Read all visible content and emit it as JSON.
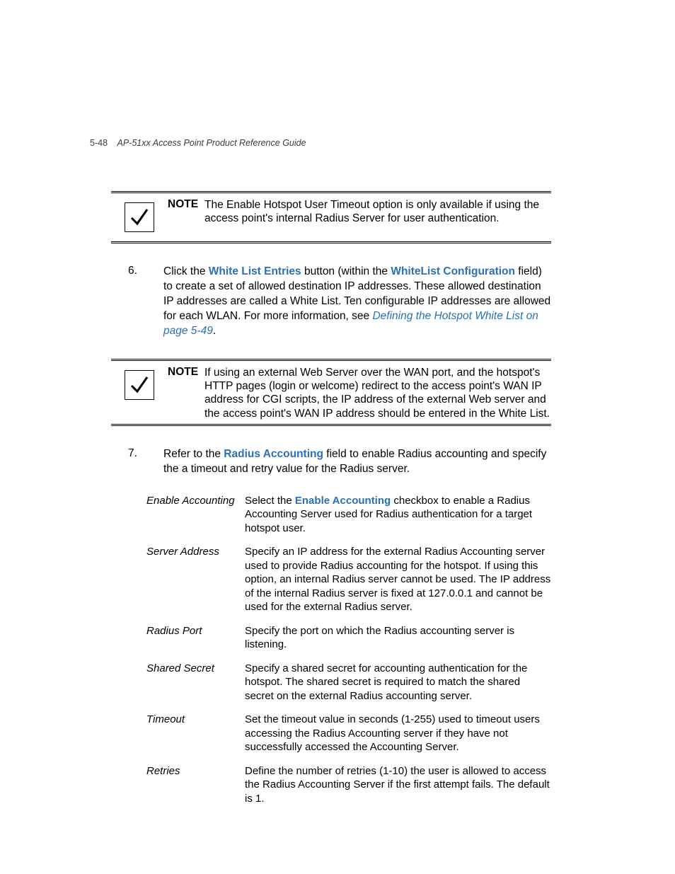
{
  "header": {
    "page_num": "5-48",
    "title": "AP-51xx Access Point Product Reference Guide"
  },
  "note1": {
    "label": "NOTE",
    "body": "The Enable Hotspot User Timeout option is only available if using the access point's internal Radius Server for user authentication."
  },
  "step6": {
    "num": "6.",
    "t1": "Click the ",
    "l1": "White List Entries",
    "t2": " button (within the ",
    "l2": "WhiteList Configuration",
    "t3": " field) to create a set of allowed destination IP addresses. These allowed destination IP addresses are called a White List. Ten configurable IP addresses are allowed for each WLAN. For more information, see ",
    "l3": "Defining the Hotspot White List on page 5-49",
    "t4": "."
  },
  "note2": {
    "label": "NOTE",
    "body": "If using an external Web Server over the WAN port, and the hotspot's HTTP pages (login or welcome) redirect to the access point's WAN IP address for CGI scripts, the IP address of the external Web server and the access point's WAN IP address should be entered in the White List."
  },
  "step7": {
    "num": "7.",
    "t1": "Refer to the ",
    "l1": "Radius Accounting",
    "t2": " field to enable Radius accounting and specify the a timeout and retry value for the Radius server."
  },
  "defs": [
    {
      "term": "Enable Accounting",
      "t1": "Select the ",
      "l1": "Enable Accounting",
      "t2": " checkbox to enable a Radius Accounting Server used for Radius authentication for a target hotspot user."
    },
    {
      "term": "Server Address",
      "desc": "Specify an IP address for the external Radius Accounting server used to provide Radius accounting for the hotspot. If using this option, an internal Radius server cannot be used. The IP address of the internal Radius server is fixed at 127.0.0.1 and cannot be used for the external Radius server."
    },
    {
      "term": "Radius Port",
      "desc": "Specify the port on which the Radius accounting server is listening."
    },
    {
      "term": "Shared Secret",
      "desc": "Specify a shared secret for accounting authentication for the hotspot. The shared secret is required to match the shared secret on the external Radius accounting server."
    },
    {
      "term": "Timeout",
      "desc": "Set the timeout value in seconds (1-255) used to timeout users accessing the Radius Accounting server if they have not successfully accessed the Accounting Server."
    },
    {
      "term": "Retries",
      "desc": "Define the number of retries (1-10) the user is allowed to access the Radius Accounting Server if the first attempt fails. The default is 1."
    }
  ]
}
